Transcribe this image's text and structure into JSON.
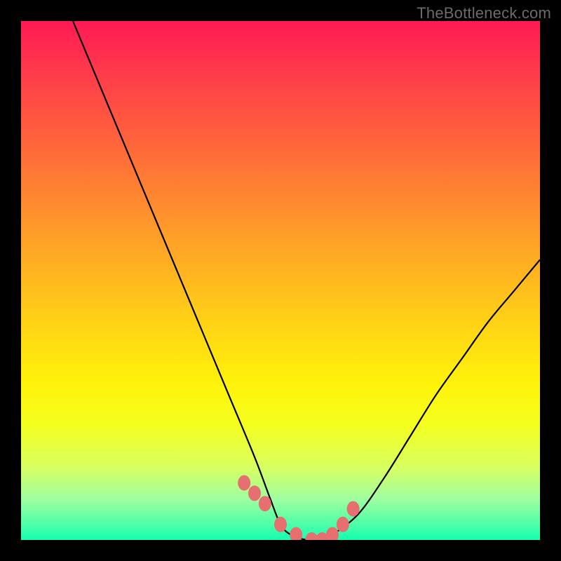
{
  "watermark": "TheBottleneck.com",
  "chart_data": {
    "type": "line",
    "title": "",
    "xlabel": "",
    "ylabel": "",
    "xlim": [
      0,
      100
    ],
    "ylim": [
      0,
      100
    ],
    "grid": false,
    "legend": false,
    "series": [
      {
        "name": "bottleneck-curve",
        "x": [
          10,
          15,
          20,
          25,
          30,
          35,
          40,
          45,
          48,
          50,
          52,
          55,
          58,
          60,
          65,
          70,
          75,
          80,
          85,
          90,
          95,
          100
        ],
        "values": [
          100,
          88,
          76,
          64,
          52,
          40,
          28,
          16,
          8,
          3,
          1,
          0,
          0,
          1,
          5,
          12,
          20,
          28,
          35,
          42,
          48,
          54
        ]
      }
    ],
    "markers": {
      "name": "highlight-points",
      "x": [
        43,
        45,
        47,
        50,
        53,
        56,
        58,
        60,
        62,
        64
      ],
      "values": [
        11,
        9,
        7,
        3,
        1,
        0,
        0,
        1,
        3,
        6
      ],
      "style": "pink-dot"
    },
    "background_gradient": {
      "top": "#ff1a55",
      "mid": "#ffd814",
      "bottom": "#13ffb0"
    }
  }
}
